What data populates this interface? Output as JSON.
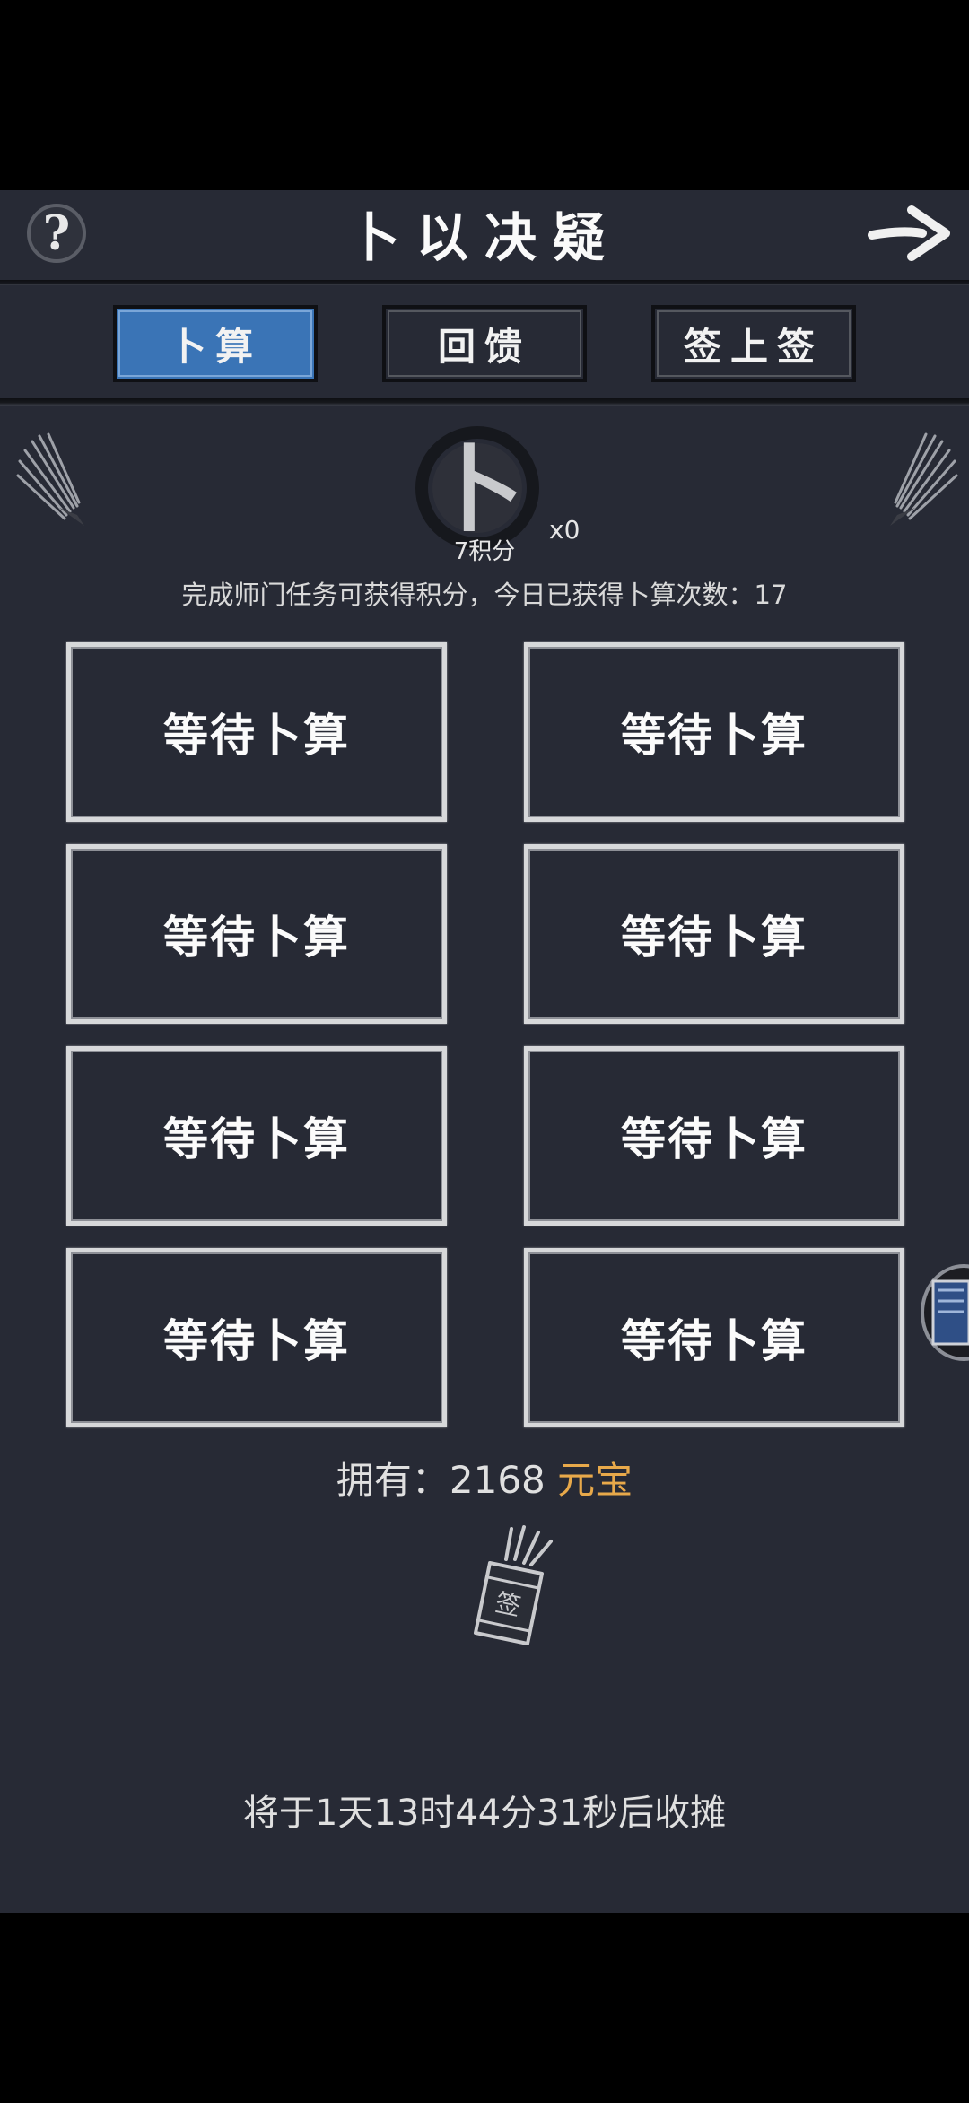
{
  "header": {
    "title": "卜以决疑",
    "help_symbol": "?",
    "help_icon": "question-mark-icon",
    "back_icon": "arrow-right-icon"
  },
  "tabs": [
    {
      "label": "卜算",
      "active": true
    },
    {
      "label": "回馈",
      "active": false
    },
    {
      "label": "签上签",
      "active": false
    }
  ],
  "divination": {
    "badge_char": "卜",
    "points_label": "7积分",
    "multiplier": "x0",
    "info_text": "完成师门任务可获得积分，今日已获得卜算次数：17"
  },
  "slots": [
    {
      "label": "等待卜算"
    },
    {
      "label": "等待卜算"
    },
    {
      "label": "等待卜算"
    },
    {
      "label": "等待卜算"
    },
    {
      "label": "等待卜算"
    },
    {
      "label": "等待卜算"
    },
    {
      "label": "等待卜算"
    },
    {
      "label": "等待卜算"
    }
  ],
  "currency": {
    "label": "拥有：",
    "amount": "2168",
    "unit": "元宝",
    "unit_color": "#e8a94a"
  },
  "lot_tube": {
    "icon": "lot-tube-icon",
    "char": "签"
  },
  "timer_text": "将于1天13时44分31秒后收摊",
  "colors": {
    "background": "#272a35",
    "active_tab": "#3a74b6"
  }
}
